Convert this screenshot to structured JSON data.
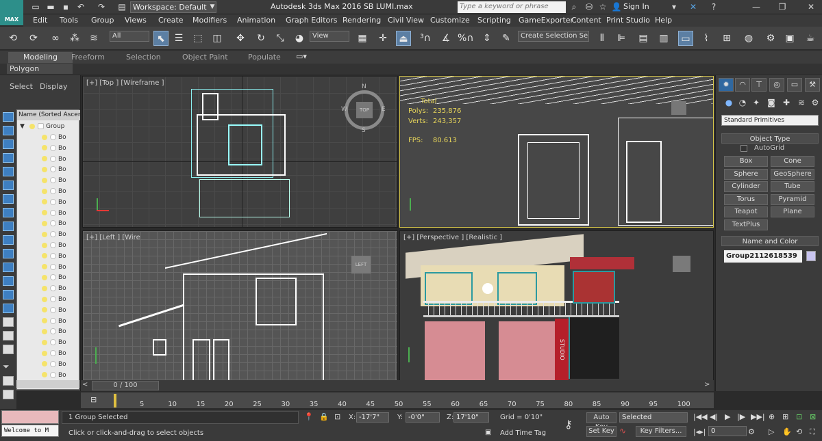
{
  "app": {
    "logo": "MAX",
    "workspace": "Workspace: Default",
    "title": "Autodesk 3ds Max 2016    SB LUMI.max",
    "search_placeholder": "Type a keyword or phrase",
    "signin": "Sign In"
  },
  "menu": [
    "Edit",
    "Tools",
    "Group",
    "Views",
    "Create",
    "Modifiers",
    "Animation",
    "Graph Editors",
    "Rendering",
    "Civil View",
    "Customize",
    "Scripting",
    "GameExporter",
    "Content",
    "Print Studio",
    "Help"
  ],
  "toolbar": {
    "selection_filter": "All",
    "ref_coord": "View",
    "named_selection": "Create Selection Se"
  },
  "ribbon": {
    "tabs": [
      "Modeling",
      "Freeform",
      "Selection",
      "Object Paint",
      "Populate"
    ],
    "panel": "Polygon Modeling"
  },
  "explorer": {
    "tabs": [
      "Select",
      "Display"
    ],
    "header": "Name (Sorted Ascen",
    "group_row": "Group",
    "row_label": "Bo"
  },
  "viewports": {
    "top": {
      "label": "[+] [Top ] [Wireframe ]",
      "cube": "TOP",
      "compass": [
        "N",
        "E",
        "S",
        "W"
      ]
    },
    "front": {
      "stats": [
        [
          "Total",
          ""
        ],
        [
          "Polys:",
          "235,876"
        ],
        [
          "Verts:",
          "243,357"
        ],
        [
          "FPS:",
          "80.613"
        ]
      ]
    },
    "left": {
      "label": "[+] [Left ] [Wire",
      "cube": "LEFT"
    },
    "persp": {
      "label": "[+] [Perspective ] [Realistic ]",
      "sign": "STUDIO"
    }
  },
  "command_panel": {
    "dropdown": "Standard Primitives",
    "object_type": "Object Type",
    "autogrid": "AutoGrid",
    "buttons": [
      "Box",
      "Cone",
      "Sphere",
      "GeoSphere",
      "Cylinder",
      "Tube",
      "Torus",
      "Pyramid",
      "Teapot",
      "Plane",
      "TextPlus"
    ],
    "name_color": "Name and Color",
    "name": "Group2112618539",
    "swatch_color": "#c8c4f0"
  },
  "timeline": {
    "frame": "0 / 100",
    "ticks": [
      "5",
      "10",
      "15",
      "20",
      "25",
      "30",
      "35",
      "40",
      "45",
      "50",
      "55",
      "60",
      "65",
      "70",
      "75",
      "80",
      "85",
      "90",
      "95",
      "100"
    ]
  },
  "status": {
    "maxscript": "Welcome to M",
    "selected": "1 Group Selected",
    "prompt": "Click or click-and-drag to select objects",
    "x_label": "X:",
    "x": "-17'7\"",
    "y_label": "Y:",
    "y": "-0'0\"",
    "z_label": "Z:",
    "z": "17'10\"",
    "grid": "Grid = 0'10\"",
    "add_time_tag": "Add Time Tag",
    "auto_key": "Auto Key",
    "key_mode": "Selected",
    "set_key": "Set Key",
    "key_filters": "Key Filters...",
    "frame_field": "0"
  }
}
